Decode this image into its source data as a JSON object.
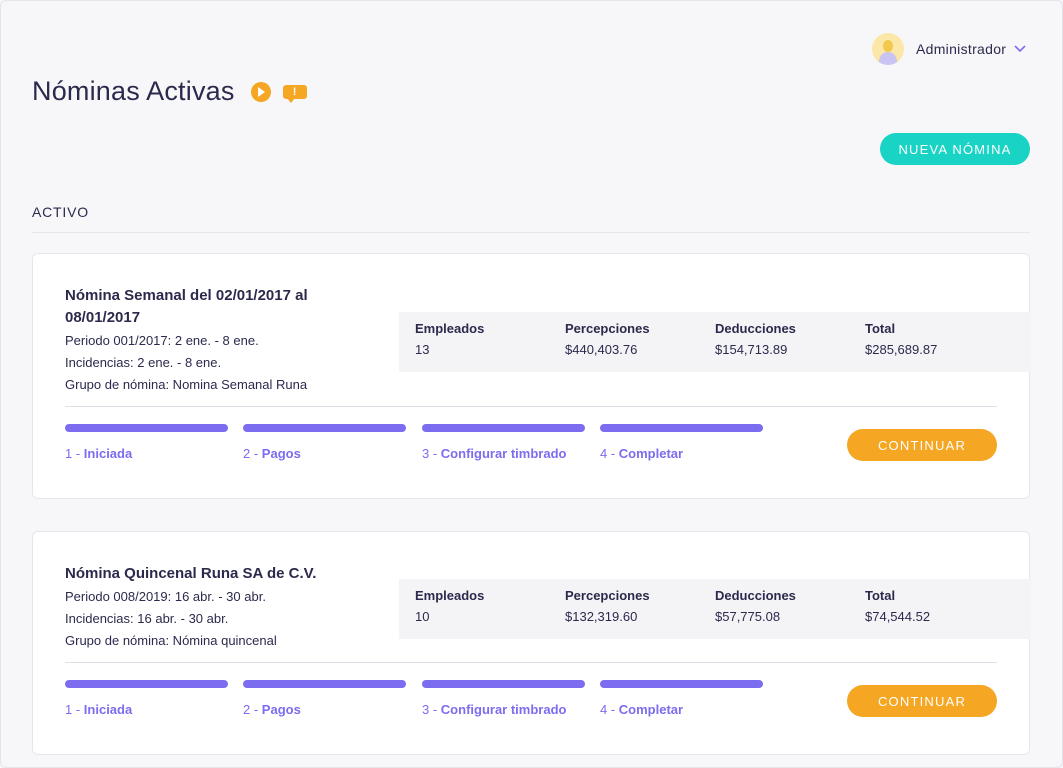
{
  "user": {
    "name": "Administrador"
  },
  "header": {
    "title": "Nóminas Activas",
    "alert_glyph": "!",
    "new_button": "NUEVA NÓMINA"
  },
  "section": {
    "label": "ACTIVO"
  },
  "payrolls": [
    {
      "title": "Nómina Semanal del 02/01/2017 al 08/01/2017",
      "periodo": "Periodo 001/2017: 2 ene. - 8 ene.",
      "incidencias": "Incidencias: 2 ene. - 8 ene.",
      "grupo": "Grupo de nómina: Nomina Semanal Runa",
      "stats": [
        {
          "label": "Empleados",
          "value": "13"
        },
        {
          "label": "Percepciones",
          "value": "$440,403.76"
        },
        {
          "label": "Deducciones",
          "value": "$154,713.89"
        },
        {
          "label": "Total",
          "value": "$285,689.87"
        }
      ],
      "steps": [
        {
          "num": "1 - ",
          "name": "Iniciada"
        },
        {
          "num": "2 - ",
          "name": "Pagos"
        },
        {
          "num": "3 - ",
          "name": "Configurar timbrado"
        },
        {
          "num": "4 - ",
          "name": "Completar"
        }
      ],
      "button": "CONTINUAR"
    },
    {
      "title": "Nómina Quincenal Runa SA de C.V.",
      "periodo": "Periodo 008/2019: 16 abr. - 30 abr.",
      "incidencias": "Incidencias: 16 abr. - 30 abr.",
      "grupo": "Grupo de nómina: Nómina quincenal",
      "stats": [
        {
          "label": "Empleados",
          "value": "10"
        },
        {
          "label": "Percepciones",
          "value": "$132,319.60"
        },
        {
          "label": "Deducciones",
          "value": "$57,775.08"
        },
        {
          "label": "Total",
          "value": "$74,544.52"
        }
      ],
      "steps": [
        {
          "num": "1 - ",
          "name": "Iniciada"
        },
        {
          "num": "2 - ",
          "name": "Pagos"
        },
        {
          "num": "3 - ",
          "name": "Configurar timbrado"
        },
        {
          "num": "4 - ",
          "name": "Completar"
        }
      ],
      "button": "CONTINUAR"
    }
  ]
}
